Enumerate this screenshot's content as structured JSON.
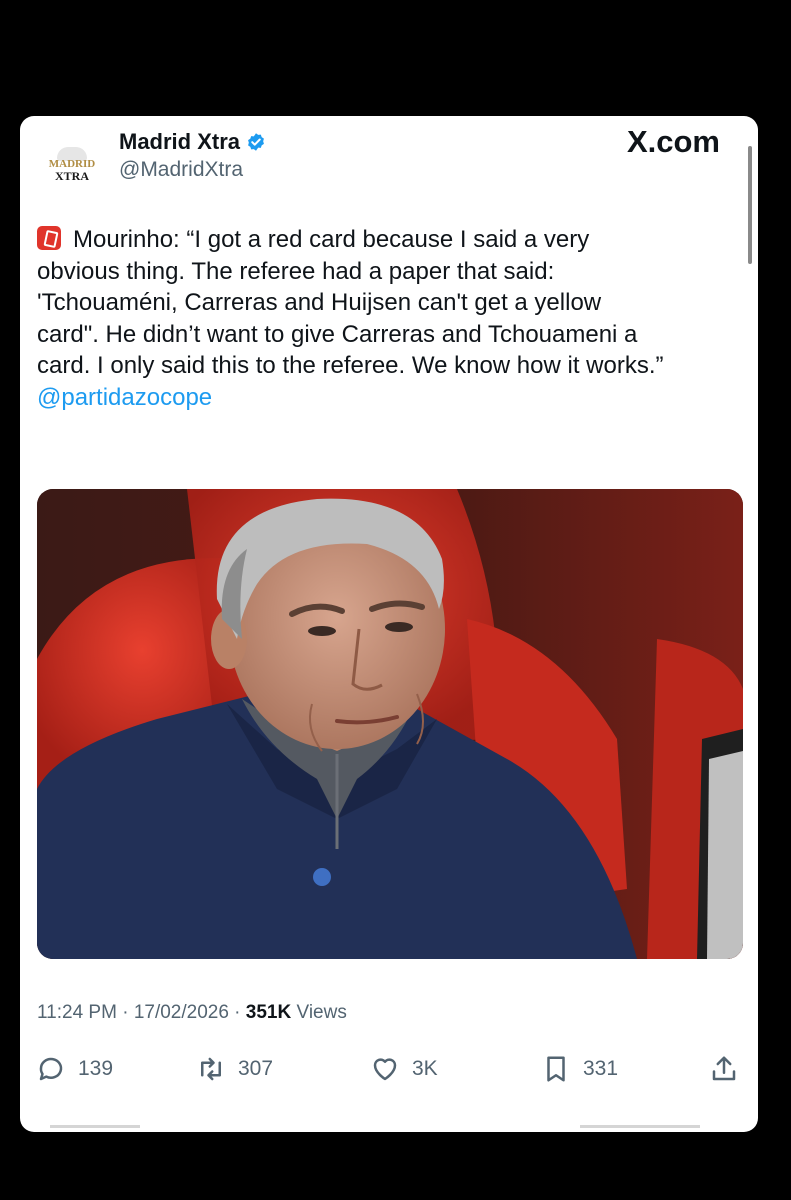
{
  "app": {
    "site_label": "X.com"
  },
  "author": {
    "display_name": "Madrid Xtra",
    "handle": "@MadridXtra",
    "avatar_text_top": "MADRID",
    "avatar_text_bottom": "XTRA",
    "verified": true
  },
  "tweet": {
    "badge_icon": "red-card-emoji",
    "lines": [
      "Mourinho: “I got a red card because I said a very",
      "obvious thing. The referee had a paper that said:",
      "'Tchouaméni, Carreras and Huijsen can't get a yellow",
      "card\". He didn’t want to give Carreras and Tchouameni a",
      "card. I only said this to the referee. We know how it works.”"
    ],
    "mention": "@partidazocope",
    "image_icon": "photo-of-man-in-dugout"
  },
  "meta": {
    "time": "11:24 PM",
    "date": "17/02/2026",
    "views_count": "351K",
    "views_label": "Views"
  },
  "actions": {
    "replies": "139",
    "reposts": "307",
    "likes": "3K",
    "bookmarks": "331"
  },
  "colors": {
    "accent": "#1d9bf0",
    "text": "#0f1419",
    "muted": "#536471"
  }
}
